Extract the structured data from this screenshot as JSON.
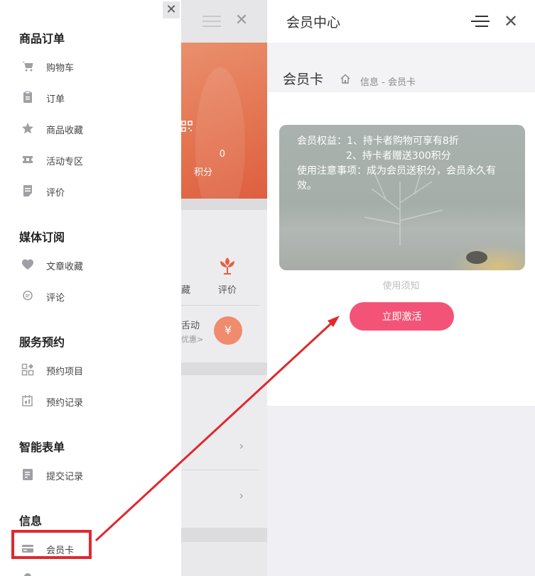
{
  "drawer": {
    "close_glyph": "✕",
    "sections": [
      {
        "title": "商品订单",
        "items": [
          {
            "label": "购物车",
            "icon": "cart-icon"
          },
          {
            "label": "订单",
            "icon": "clipboard-icon"
          },
          {
            "label": "商品收藏",
            "icon": "star-icon"
          },
          {
            "label": "活动专区",
            "icon": "ticket-icon"
          },
          {
            "label": "评价",
            "icon": "document-icon"
          }
        ]
      },
      {
        "title": "媒体订阅",
        "items": [
          {
            "label": "文章收藏",
            "icon": "heart-icon"
          },
          {
            "label": "评论",
            "icon": "comment-icon"
          }
        ]
      },
      {
        "title": "服务预约",
        "items": [
          {
            "label": "预约项目",
            "icon": "apps-icon"
          },
          {
            "label": "预约记录",
            "icon": "calendar-icon"
          }
        ]
      },
      {
        "title": "智能表单",
        "items": [
          {
            "label": "提交记录",
            "icon": "form-icon"
          }
        ]
      },
      {
        "title": "信息",
        "items": [
          {
            "label": "会员卡",
            "icon": "card-icon"
          }
        ]
      }
    ]
  },
  "middle": {
    "points_value": "0",
    "points_label": "积分",
    "rate_label": "评价",
    "cut_label": "藏",
    "activity_title": "舌动",
    "activity_sub": "优惠>",
    "coupon_glyph": "¥",
    "chevron": "›"
  },
  "right": {
    "header_title": "会员中心",
    "close_glyph": "✕",
    "page_title": "会员卡",
    "breadcrumb": "信息 - 会员卡",
    "card": {
      "line1": "会员权益：1、持卡者购物可享有8折",
      "line2": "2、持卡者赠送300积分",
      "line3": "使用注意事项：成为会员送积分，会员永久有",
      "line4": "效。"
    },
    "notice": "使用须知",
    "activate_label": "立即激活"
  },
  "colors": {
    "accent": "#f45378",
    "banner": "#e3724f",
    "highlight": "#e0282d"
  }
}
